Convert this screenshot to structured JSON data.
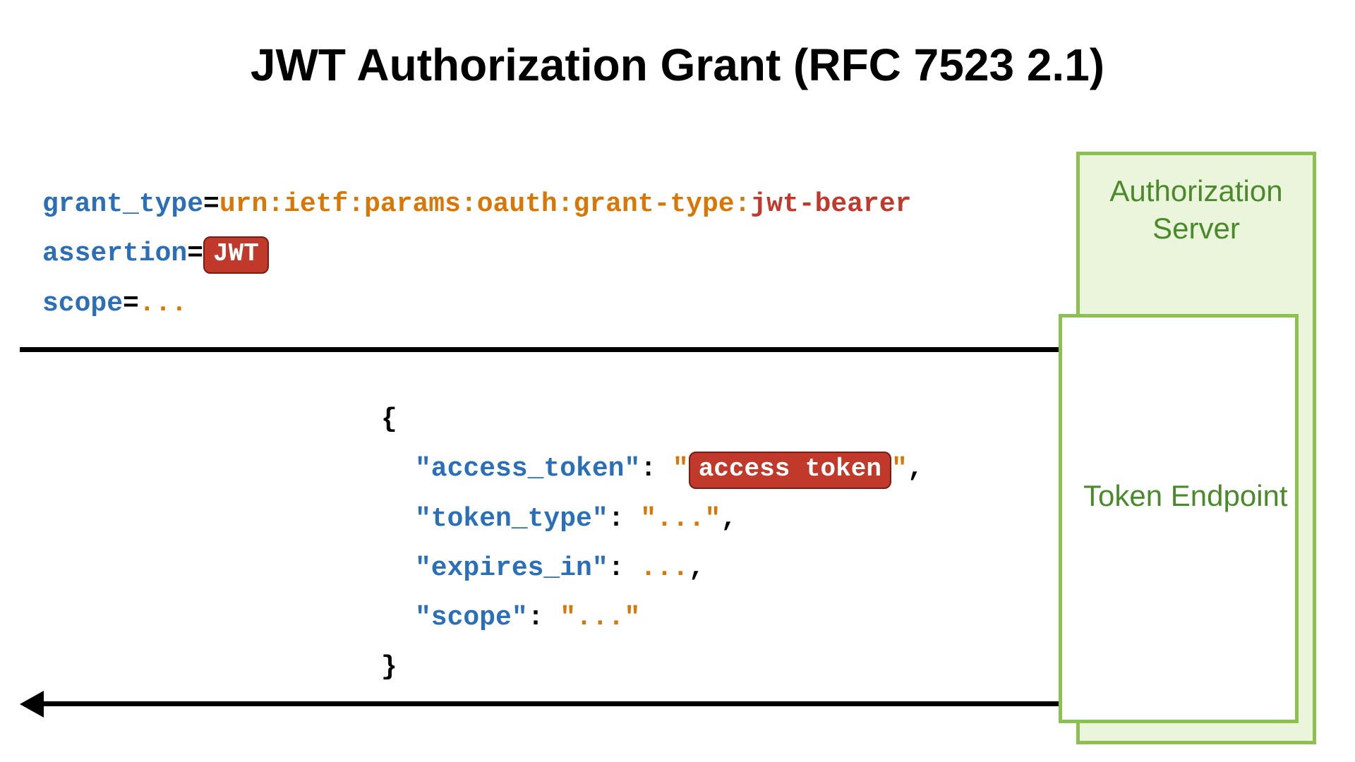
{
  "title": "JWT Authorization Grant (RFC 7523 2.1)",
  "request": {
    "grant_type_key": "grant_type",
    "grant_type_value_prefix": "urn:ietf:params:oauth:grant-type:",
    "grant_type_value_suffix": "jwt-bearer",
    "assertion_key": "assertion",
    "assertion_badge": "JWT",
    "scope_key": "scope",
    "scope_value": "..."
  },
  "response": {
    "open_brace": "{",
    "access_token_key": "\"access_token\"",
    "access_token_badge": "access token",
    "token_type_key": "\"token_type\"",
    "token_type_value": "\"...\"",
    "expires_in_key": "\"expires_in\"",
    "expires_in_value": "...",
    "scope_key": "\"scope\"",
    "scope_value": "\"...\"",
    "close_brace": "}"
  },
  "server": {
    "auth_label": "Authorization Server",
    "token_label": "Token Endpoint"
  },
  "punct": {
    "eq": "=",
    "colon": ":",
    "comma": ",",
    "quote": "\""
  }
}
